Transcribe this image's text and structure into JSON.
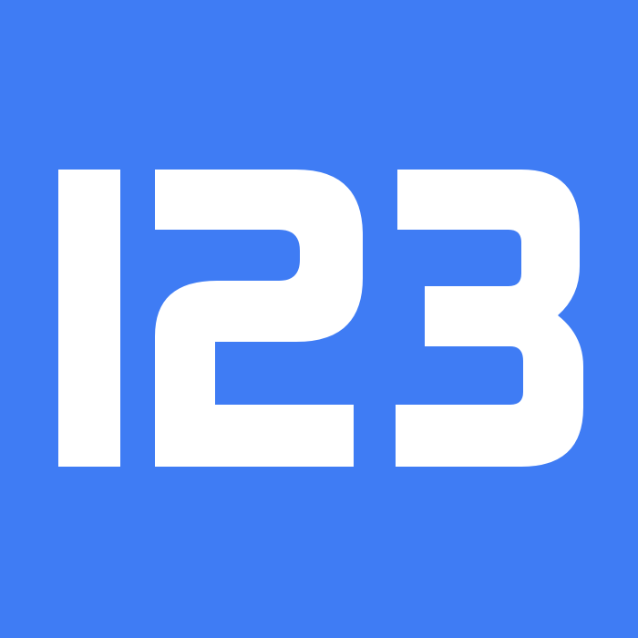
{
  "logo": {
    "text": "123",
    "background_color": "#3f7cf4",
    "glyph_color": "#ffffff",
    "digits": [
      "1",
      "2",
      "3"
    ]
  }
}
